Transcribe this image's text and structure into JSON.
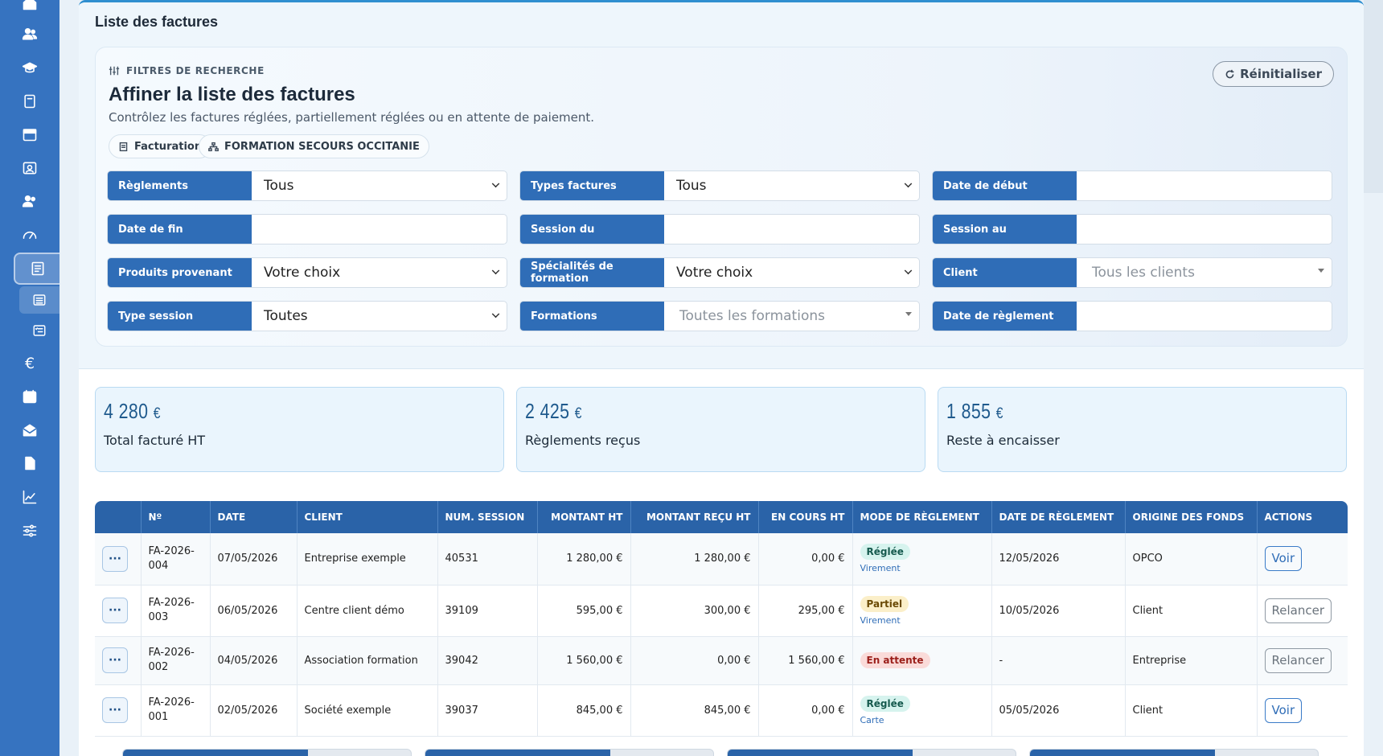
{
  "sidebar": {
    "icons": [
      "home-icon",
      "users-icon",
      "graduation-cap-icon",
      "book-icon",
      "calendar-icon",
      "id-card-icon",
      "team-icon",
      "dashboard-gauge-icon",
      "invoice-icon",
      "list-icon",
      "checklist-icon",
      "euro-icon",
      "calendar-alt-icon",
      "envelope-open-icon",
      "file-icon",
      "chart-line-icon",
      "sliders-icon"
    ],
    "euro_glyph": "€"
  },
  "page": {
    "title": "Liste des factures"
  },
  "filters": {
    "kicker": "FILTRES DE RECHERCHE",
    "title": "Affiner la liste des factures",
    "description": "Contrôlez les factures réglées, partiellement réglées ou en attente de paiement.",
    "reset_label": "Réinitialiser",
    "chips": [
      "Facturation",
      "FORMATION SECOURS OCCITANIE"
    ],
    "fields": [
      {
        "label": "Règlements",
        "value": "Tous",
        "kind": "select"
      },
      {
        "label": "Types factures",
        "value": "Tous",
        "kind": "select"
      },
      {
        "label": "Date de début",
        "value": "",
        "kind": "input"
      },
      {
        "label": "Date de fin",
        "value": "",
        "kind": "input"
      },
      {
        "label": "Session du",
        "value": "",
        "kind": "input"
      },
      {
        "label": "Session au",
        "value": "",
        "kind": "input"
      },
      {
        "label": "Produits provenant",
        "value": "Votre choix",
        "kind": "select"
      },
      {
        "label": "Spécialités de formation",
        "value": "Votre choix",
        "kind": "select"
      },
      {
        "label": "Client",
        "value": "Tous les clients",
        "kind": "combo"
      },
      {
        "label": "Type session",
        "value": "Toutes",
        "kind": "select"
      },
      {
        "label": "Formations",
        "value": "Toutes les formations",
        "kind": "combo"
      },
      {
        "label": "Date de règlement",
        "value": "",
        "kind": "input"
      }
    ]
  },
  "stats": [
    {
      "amount": "4 280",
      "currency": "€",
      "label": "Total facturé HT"
    },
    {
      "amount": "2 425",
      "currency": "€",
      "label": "Règlements reçus"
    },
    {
      "amount": "1 855",
      "currency": "€",
      "label": "Reste à encaisser"
    }
  ],
  "table": {
    "menu_glyph": "···",
    "headers": [
      "",
      "Nº",
      "DATE",
      "CLIENT",
      "NUM. SESSION",
      "MONTANT HT",
      "MONTANT REÇU HT",
      "EN COURS HT",
      "MODE DE RÈGLEMENT",
      "DATE DE RÈGLEMENT",
      "ORIGINE DES FONDS",
      "ACTIONS"
    ],
    "rows": [
      {
        "num_a": "FA-2026-",
        "num_b": "004",
        "date": "07/05/2026",
        "client": "Entreprise exemple",
        "session": "40531",
        "ht": "1 280,00 €",
        "recu": "1 280,00 €",
        "encours": "0,00 €",
        "status": "Réglée",
        "status_kind": "ok",
        "mode": "Virement",
        "date_reg": "12/05/2026",
        "origine": "OPCO",
        "action": "Voir"
      },
      {
        "num_a": "FA-2026-",
        "num_b": "003",
        "date": "06/05/2026",
        "client": "Centre client démo",
        "session": "39109",
        "ht": "595,00 €",
        "recu": "300,00 €",
        "encours": "295,00 €",
        "status": "Partiel",
        "status_kind": "part",
        "mode": "Virement",
        "date_reg": "10/05/2026",
        "origine": "Client",
        "action": "Relancer"
      },
      {
        "num_a": "FA-2026-",
        "num_b": "002",
        "date": "04/05/2026",
        "client": "Association formation",
        "session": "39042",
        "ht": "1 560,00 €",
        "recu": "0,00 €",
        "encours": "1 560,00 €",
        "status": "En attente",
        "status_kind": "wait",
        "mode": "",
        "date_reg": "-",
        "origine": "Entreprise",
        "action": "Relancer"
      },
      {
        "num_a": "FA-2026-",
        "num_b": "001",
        "date": "02/05/2026",
        "client": "Société exemple",
        "session": "39037",
        "ht": "845,00 €",
        "recu": "845,00 €",
        "encours": "0,00 €",
        "status": "Réglée",
        "status_kind": "ok",
        "mode": "Carte",
        "date_reg": "05/05/2026",
        "origine": "Client",
        "action": "Voir"
      }
    ]
  },
  "colors": {
    "sidebar": "#3673c0",
    "header": "#2a63a8",
    "accent": "#2f6db7"
  }
}
